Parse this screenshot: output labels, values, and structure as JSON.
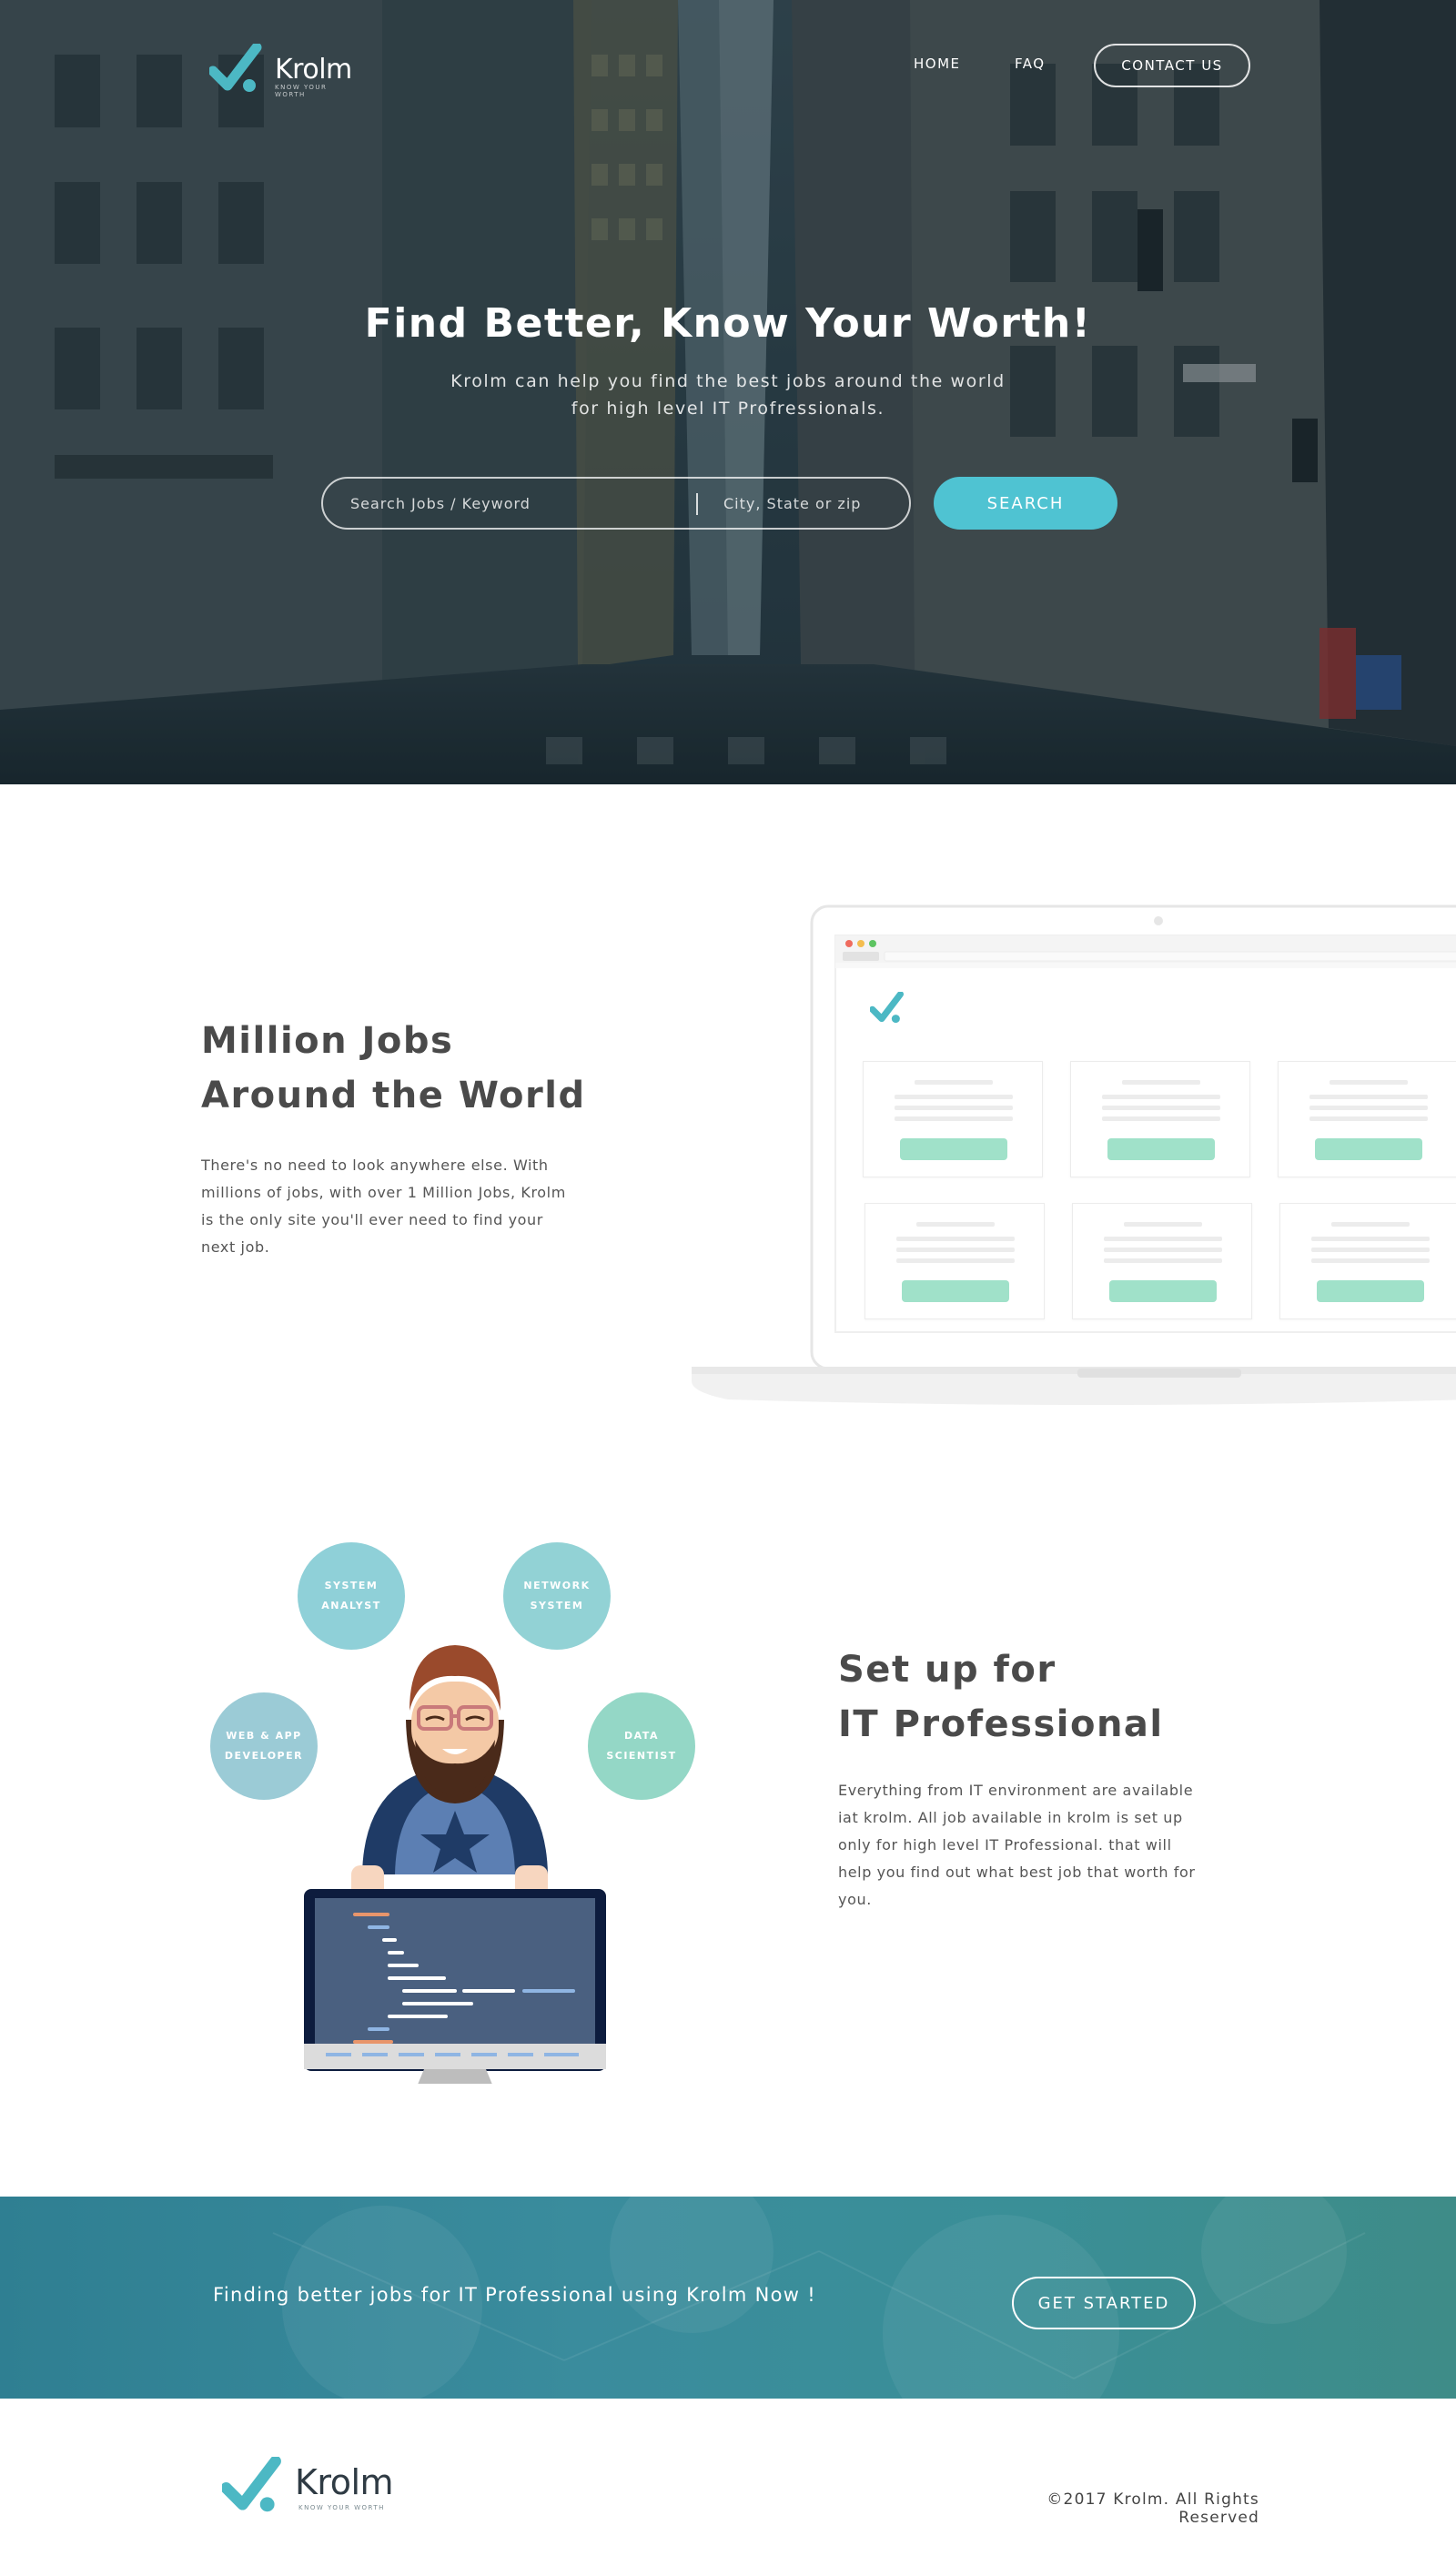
{
  "brand": {
    "name": "Krolm",
    "tagline": "KNOW YOUR WORTH",
    "accent": "#4fc3d2",
    "mark_color": "#4cb8c4",
    "text_dark": "#4a4a4a"
  },
  "nav": {
    "home": "HOME",
    "faq": "FAQ",
    "contact": "CONTACT US"
  },
  "hero": {
    "title": "Find Better, Know Your Worth!",
    "subtitle_line1": "Krolm can help you find the best jobs around the world",
    "subtitle_line2": "for high level IT Profressionals.",
    "search_placeholder": "Search Jobs / Keyword",
    "location_placeholder": "City, State or zip",
    "search_button": "SEARCH"
  },
  "jobs_section": {
    "heading_line1": "Million Jobs",
    "heading_line2": "Around the World",
    "body": "There's no need to look anywhere else. With millions of jobs, with over 1 Million Jobs, Krolm is the only site you'll ever need to find your next job."
  },
  "pro_section": {
    "heading_line1": "Set up for",
    "heading_line2": "IT Professional",
    "body": "Everything from IT environment are available iat krolm. All job available in krolm is set up only for high level IT Professional. that will help you find out what best job that worth for you.",
    "bubbles": {
      "system_analyst": [
        "SYSTEM",
        "ANALYST"
      ],
      "network_system": [
        "NETWORK",
        "SYSTEM"
      ],
      "web_app": [
        "WEB & APP",
        "DEVELOPER"
      ],
      "data_scientist": [
        "DATA",
        "SCIENTIST"
      ]
    }
  },
  "cta": {
    "text": "Finding better jobs for IT Professional using Krolm Now !",
    "button": "GET STARTED"
  },
  "footer": {
    "copyright": "©2017 Krolm. All Rights Reserved"
  }
}
